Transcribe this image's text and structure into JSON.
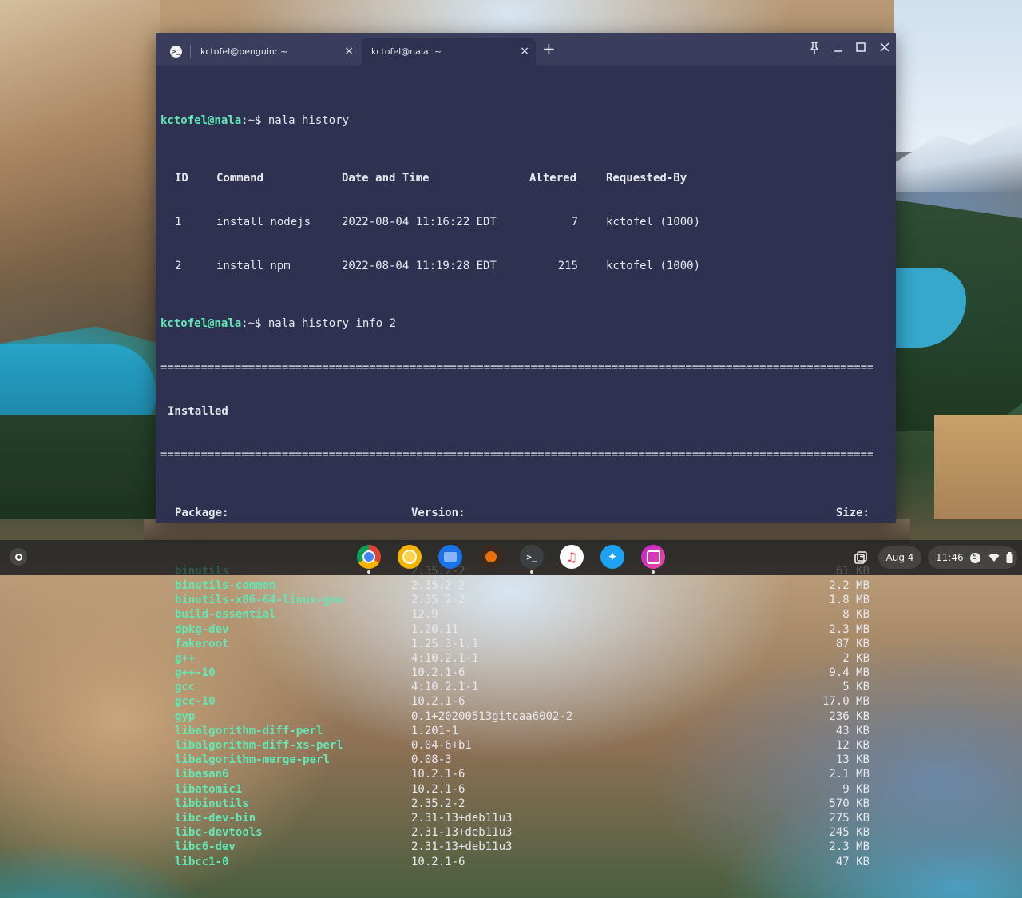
{
  "window": {
    "tabs": [
      {
        "label": "kctofel@penguin: ~",
        "active": false
      },
      {
        "label": "kctofel@nala: ~",
        "active": true
      }
    ],
    "new_tab_symbol": "+",
    "close_symbol": "×",
    "controls": {
      "pin": "pin-icon",
      "minimize": "minimize-icon",
      "maximize": "maximize-icon",
      "close": "close-icon"
    }
  },
  "terminal": {
    "prompt_user": "kctofel@nala",
    "prompt_suffix": ":~$ ",
    "cmd1": "nala history",
    "history_headers": [
      "ID",
      "Command",
      "Date and Time",
      "Altered",
      "Requested-By"
    ],
    "history_rows": [
      {
        "id": "1",
        "command": "install nodejs",
        "date": "2022-08-04 11:16:22 EDT",
        "altered": "7",
        "by": "kctofel (1000)"
      },
      {
        "id": "2",
        "command": "install npm",
        "date": "2022-08-04 11:19:28 EDT",
        "altered": "215",
        "by": "kctofel (1000)"
      }
    ],
    "cmd2": "nala history info 2",
    "rule": "==========================================================================================================",
    "section_title": "Installed",
    "pkg_headers": {
      "package": "Package:",
      "version": "Version:",
      "size": "Size:"
    },
    "packages": [
      {
        "name": "binutils",
        "version": "2.35.2-2",
        "size": "61 KB"
      },
      {
        "name": "binutils-common",
        "version": "2.35.2-2",
        "size": "2.2 MB"
      },
      {
        "name": "binutils-x86-64-linux-gnu",
        "version": "2.35.2-2",
        "size": "1.8 MB"
      },
      {
        "name": "build-essential",
        "version": "12.9",
        "size": "8 KB"
      },
      {
        "name": "dpkg-dev",
        "version": "1.20.11",
        "size": "2.3 MB"
      },
      {
        "name": "fakeroot",
        "version": "1.25.3-1.1",
        "size": "87 KB"
      },
      {
        "name": "g++",
        "version": "4:10.2.1-1",
        "size": "2 KB"
      },
      {
        "name": "g++-10",
        "version": "10.2.1-6",
        "size": "9.4 MB"
      },
      {
        "name": "gcc",
        "version": "4:10.2.1-1",
        "size": "5 KB"
      },
      {
        "name": "gcc-10",
        "version": "10.2.1-6",
        "size": "17.0 MB"
      },
      {
        "name": "gyp",
        "version": "0.1+20200513gitcaa6002-2",
        "size": "236 KB"
      },
      {
        "name": "libalgorithm-diff-perl",
        "version": "1.201-1",
        "size": "43 KB"
      },
      {
        "name": "libalgorithm-diff-xs-perl",
        "version": "0.04-6+b1",
        "size": "12 KB"
      },
      {
        "name": "libalgorithm-merge-perl",
        "version": "0.08-3",
        "size": "13 KB"
      },
      {
        "name": "libasan6",
        "version": "10.2.1-6",
        "size": "2.1 MB"
      },
      {
        "name": "libatomic1",
        "version": "10.2.1-6",
        "size": "9 KB"
      },
      {
        "name": "libbinutils",
        "version": "2.35.2-2",
        "size": "570 KB"
      },
      {
        "name": "libc-dev-bin",
        "version": "2.31-13+deb11u3",
        "size": "275 KB"
      },
      {
        "name": "libc-devtools",
        "version": "2.31-13+deb11u3",
        "size": "245 KB"
      },
      {
        "name": "libc6-dev",
        "version": "2.31-13+deb11u3",
        "size": "2.3 MB"
      },
      {
        "name": "libcc1-0",
        "version": "10.2.1-6",
        "size": "47 KB"
      }
    ]
  },
  "shelf": {
    "apps": [
      {
        "name": "chrome-icon",
        "color": "#db4437"
      },
      {
        "name": "chrome-canary-icon",
        "color": "#f4b400"
      },
      {
        "name": "files-icon",
        "color": "#1a73e8"
      },
      {
        "name": "sketch-app-icon",
        "color": "#e8710a"
      },
      {
        "name": "terminal-icon",
        "color": "#3c4043"
      },
      {
        "name": "music-icon",
        "color": "#fc3c44"
      },
      {
        "name": "twitter-icon",
        "color": "#1da1f2"
      },
      {
        "name": "photo-app-icon",
        "color": "#c026d3"
      }
    ],
    "date": "Aug 4",
    "time": "11:46",
    "notification_count": "5"
  }
}
